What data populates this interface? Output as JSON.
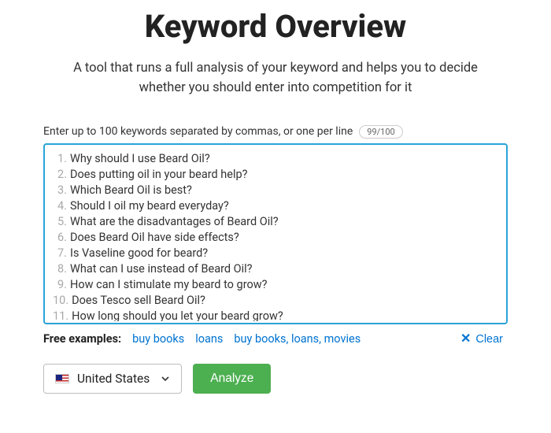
{
  "header": {
    "title": "Keyword Overview",
    "subtitle": "A tool that runs a full analysis of your keyword and helps you to decide whether you should enter into competition for it"
  },
  "input": {
    "hint": "Enter up to 100 keywords separated by commas, or one per line",
    "counter": "99/100",
    "keywords": [
      "Why should I use Beard Oil?",
      "Does putting oil in your beard help?",
      "Which Beard Oil is best?",
      "Should I oil my beard everyday?",
      "What are the disadvantages of Beard Oil?",
      "Does Beard Oil have side effects?",
      "Is Vaseline good for beard?",
      "What can I use instead of Beard Oil?",
      "How can I stimulate my beard to grow?",
      "Does Tesco sell Beard Oil?",
      "How long should you let your beard grow?"
    ]
  },
  "examples": {
    "label": "Free examples:",
    "items": [
      "buy books",
      "loans",
      "buy books, loans, movies"
    ]
  },
  "clear_label": "Clear",
  "country": {
    "selected": "United States"
  },
  "analyze_label": "Analyze"
}
